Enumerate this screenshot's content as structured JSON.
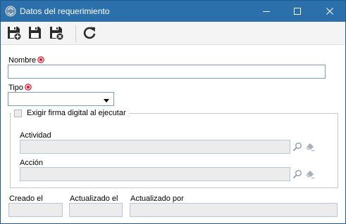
{
  "window": {
    "title": "Datos del requerimiento",
    "controls": [
      "minimize-icon",
      "maximize-icon",
      "close-icon"
    ]
  },
  "toolbar": {
    "buttons": [
      "save-new-icon",
      "save-icon",
      "save-close-icon",
      "refresh-icon"
    ]
  },
  "form": {
    "nombre": {
      "label": "Nombre",
      "value": "",
      "required": true
    },
    "tipo": {
      "label": "Tipo",
      "selected": "",
      "required": true
    },
    "firma": {
      "label": "Exigir firma digital al ejecutar",
      "checked": false
    },
    "actividad": {
      "label": "Actividad",
      "value": ""
    },
    "accion": {
      "label": "Acción",
      "value": ""
    },
    "creado_el": {
      "label": "Creado el",
      "value": ""
    },
    "actualizado_el": {
      "label": "Actualizado el",
      "value": ""
    },
    "actualizado_por": {
      "label": "Actualizado por",
      "value": ""
    }
  },
  "colors": {
    "titlebar": "#2b6fab",
    "required_marker": "#d9001b",
    "input_border": "#7a9bc2",
    "disabled_bg": "#ececec"
  }
}
